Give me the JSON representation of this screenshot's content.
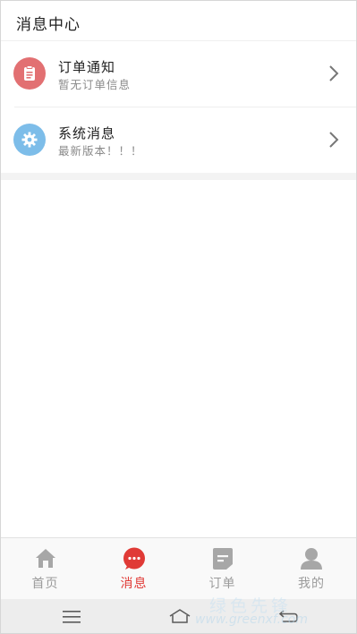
{
  "header": {
    "title": "消息中心"
  },
  "messages": [
    {
      "title": "订单通知",
      "subtitle": "暂无订单信息",
      "icon": "clipboard-icon",
      "color": "#e27072"
    },
    {
      "title": "系统消息",
      "subtitle": "最新版本！！！",
      "icon": "gear-icon",
      "color": "#7dbde9"
    }
  ],
  "tabs": [
    {
      "label": "首页",
      "icon": "home-icon",
      "active": false
    },
    {
      "label": "消息",
      "icon": "chat-bubble-icon",
      "active": true
    },
    {
      "label": "订单",
      "icon": "order-icon",
      "active": false
    },
    {
      "label": "我的",
      "icon": "user-icon",
      "active": false
    }
  ],
  "colors": {
    "accent": "#e03a36",
    "inactive": "#9b9b9b"
  },
  "system_bar": {
    "buttons": [
      "menu-icon",
      "home-outline-icon",
      "back-icon"
    ]
  },
  "watermark": {
    "brand": "绿色先锋",
    "url": "www.greenxf.com"
  }
}
